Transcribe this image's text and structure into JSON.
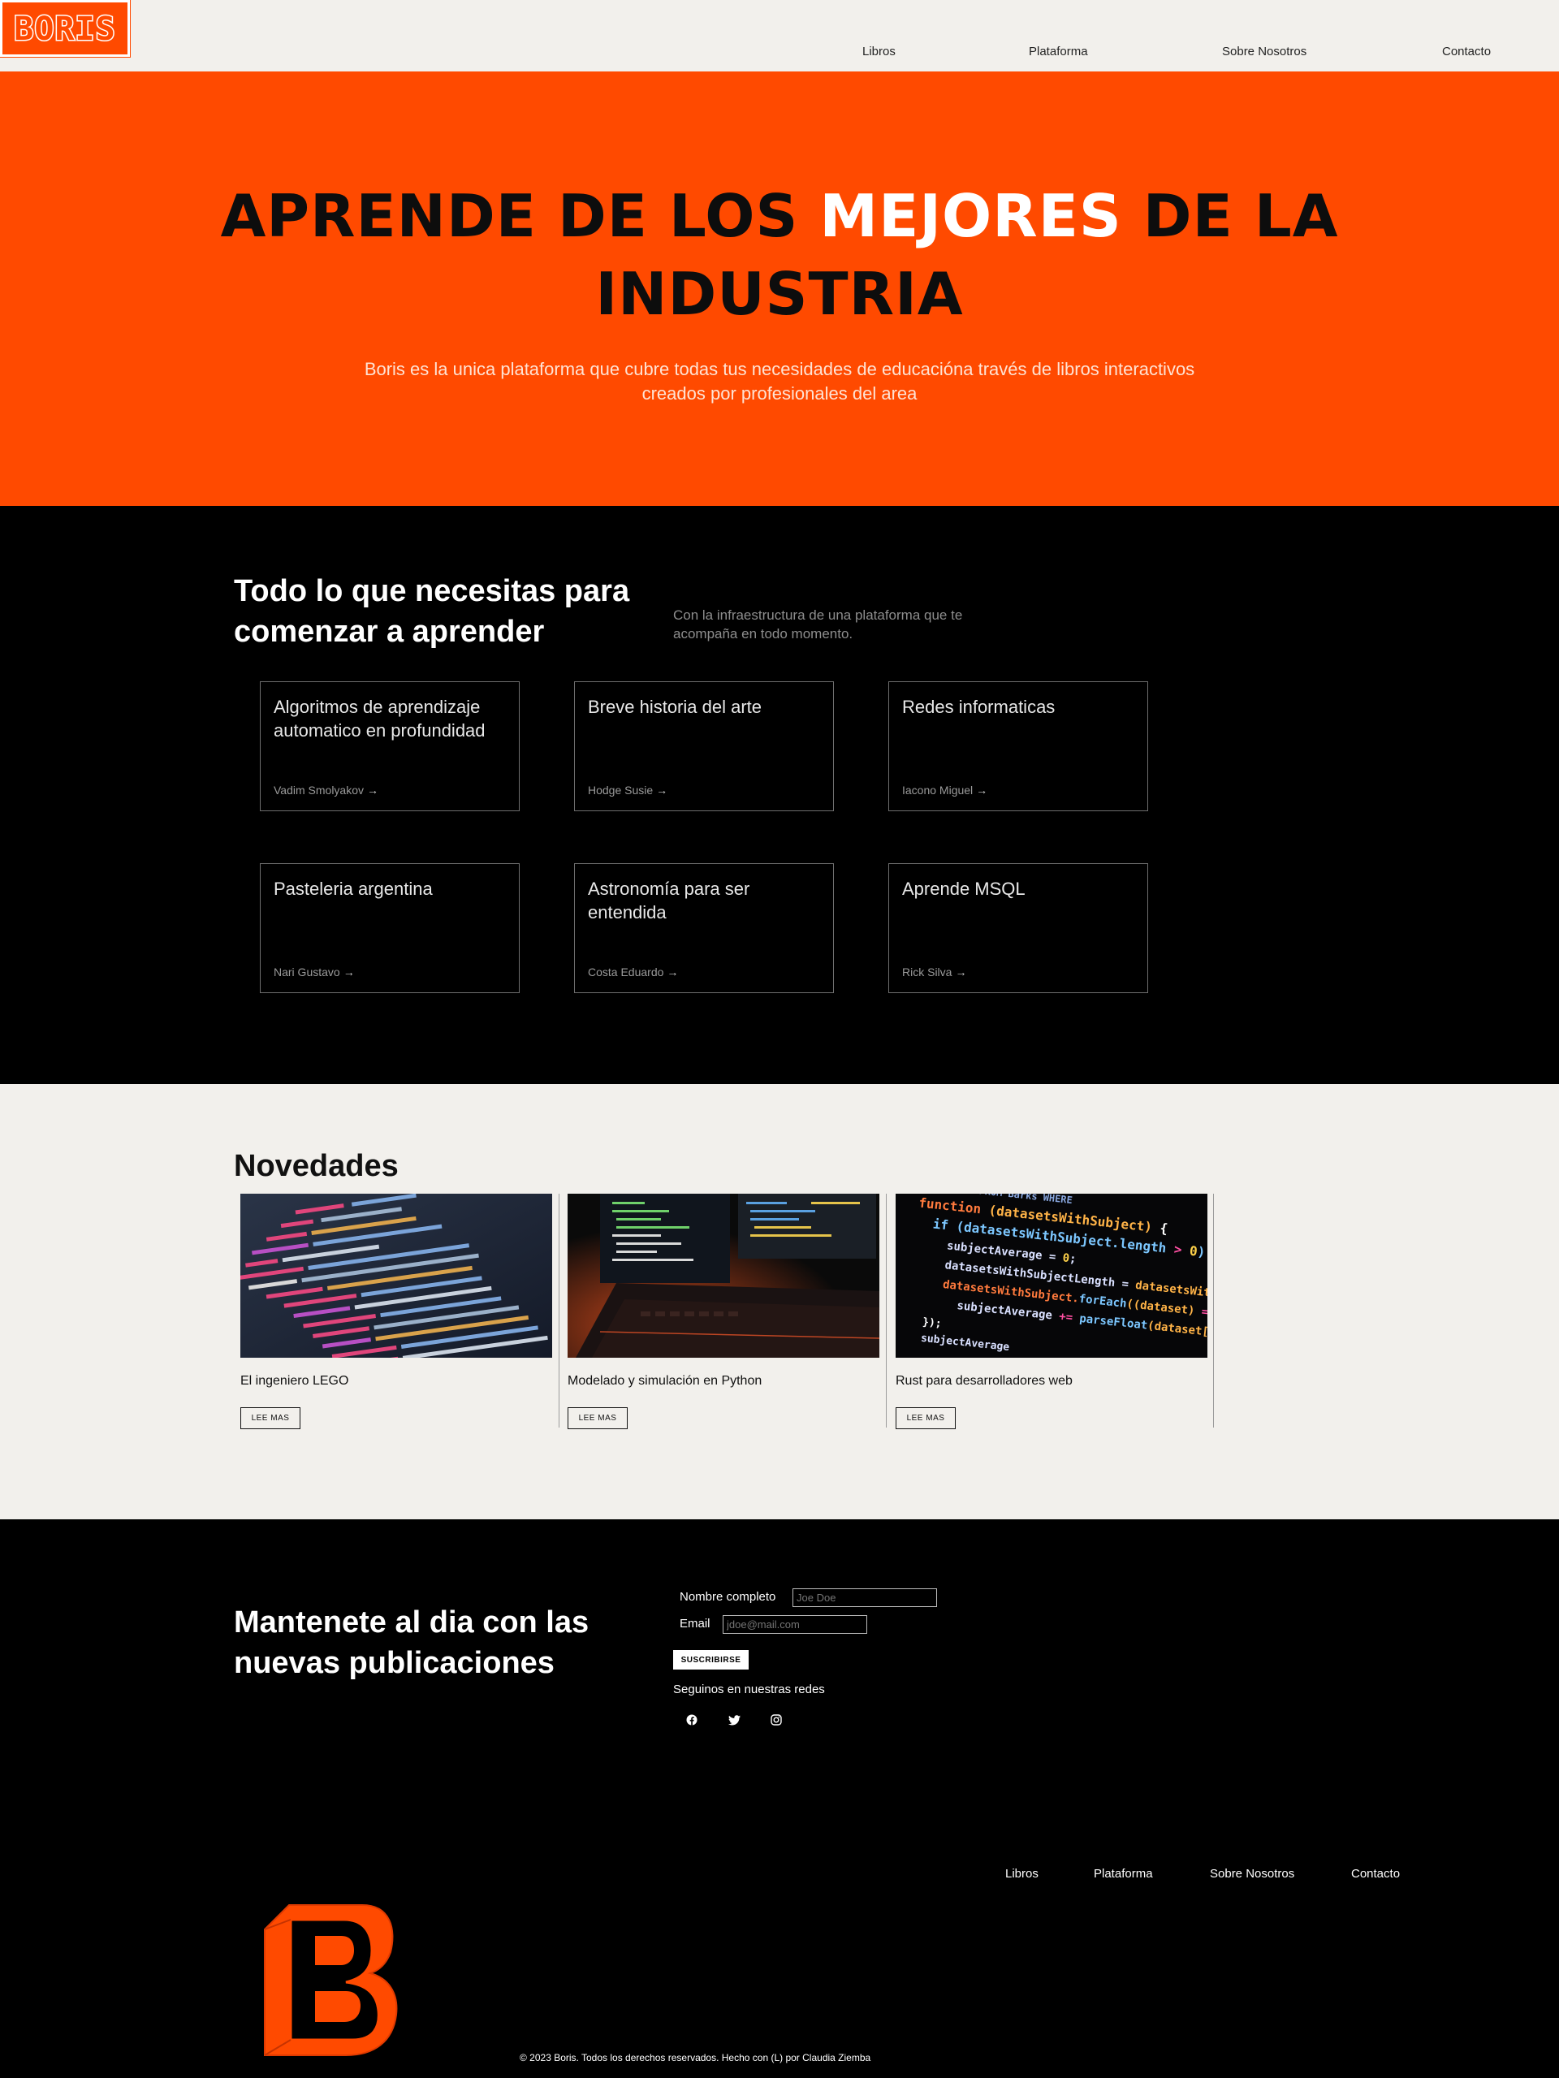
{
  "brand": {
    "logo_text": "BORIS",
    "accent": "#ff4a00"
  },
  "nav": {
    "items": [
      "Libros",
      "Plataforma",
      "Sobre Nosotros",
      "Contacto"
    ]
  },
  "hero": {
    "title_part1": "APRENDE DE LOS ",
    "title_highlight": "MEJORES",
    "title_part2": " DE LA",
    "title_line2": "INDUSTRIA",
    "subtitle_line1": "Boris es la unica plataforma que cubre todas tus necesidades de educacióna través de libros interactivos",
    "subtitle_line2": "creados por profesionales del area"
  },
  "courses": {
    "title": "Todo lo que necesitas para comenzar a aprender",
    "description": "Con la infraestructura de una plataforma que te acompaña en todo momento.",
    "cards": [
      {
        "title": "Algoritmos de aprendizaje automatico en profundidad",
        "author": "Vadim Smolyakov"
      },
      {
        "title": "Breve historia del arte",
        "author": "Hodge Susie"
      },
      {
        "title": "Redes informaticas",
        "author": "Iacono Miguel"
      },
      {
        "title": "Pasteleria argentina",
        "author": "Nari Gustavo"
      },
      {
        "title": "Astronomía para ser entendida",
        "author": "Costa Eduardo"
      },
      {
        "title": "Aprende MSQL",
        "author": "Rick Silva"
      }
    ],
    "arrow_icon": "arrow-right-icon"
  },
  "news": {
    "title": "Novedades",
    "button_label": "LEE MAS",
    "items": [
      {
        "title": "El ingeniero LEGO",
        "image": "code-screen-photo"
      },
      {
        "title": "Modelado y simulación en Python",
        "image": "laptop-code-photo"
      },
      {
        "title": "Rust para desarrolladores web",
        "image": "colorful-code-photo"
      }
    ]
  },
  "subscribe": {
    "title": "Mantenete al dia con las nuevas publicaciones",
    "name_label": "Nombre completo",
    "name_placeholder": "Joe Doe",
    "email_label": "Email",
    "email_placeholder": "jdoe@mail.com",
    "button_label": "SUSCRIBIRSE",
    "follow_label": "Seguinos en nuestras redes",
    "social_icons": [
      "facebook-icon",
      "twitter-icon",
      "instagram-icon"
    ]
  },
  "footer": {
    "nav": [
      "Libros",
      "Plataforma",
      "Sobre Nosotros",
      "Contacto"
    ],
    "copyright": "© 2023 Boris. Todos los derechos reservados. Hecho con (L) por Claudia Ziemba"
  }
}
